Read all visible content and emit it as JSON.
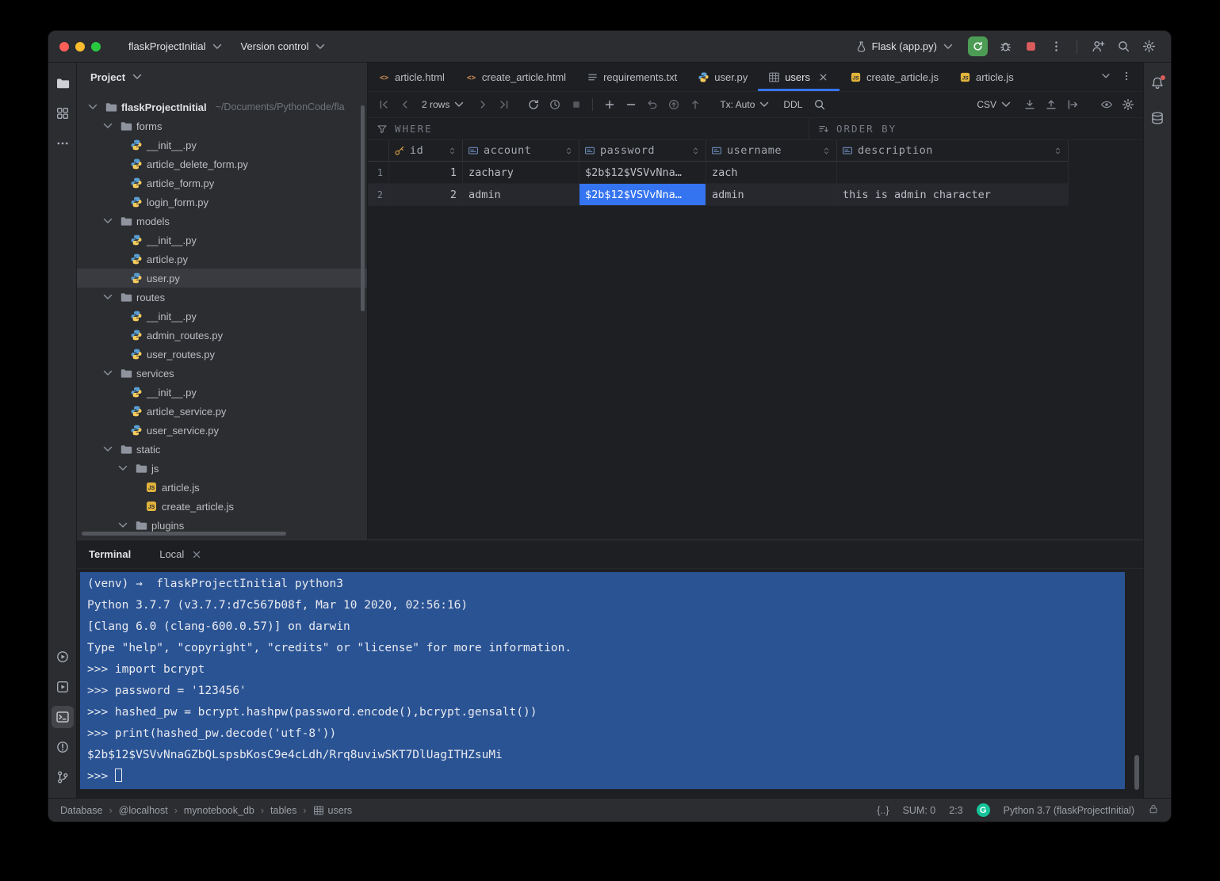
{
  "window": {
    "titlebar": {
      "project_menu": "flaskProjectInitial",
      "vcs_menu": "Version control",
      "run_config": "Flask (app.py)"
    }
  },
  "activity_bar": {
    "top": [
      "project",
      "structure",
      "more"
    ],
    "bottom": [
      "run",
      "services",
      "terminal",
      "problems",
      "version-control"
    ],
    "active": "terminal"
  },
  "right_bar": [
    "notifications",
    "database"
  ],
  "project": {
    "header": "Project",
    "tree": [
      {
        "depth": 0,
        "kind": "folder",
        "label": "flaskProjectInitial",
        "suffix": "~/Documents/PythonCode/fla",
        "expanded": true
      },
      {
        "depth": 1,
        "kind": "folder",
        "label": "forms",
        "expanded": true
      },
      {
        "depth": 2,
        "kind": "py",
        "label": "__init__.py"
      },
      {
        "depth": 2,
        "kind": "py",
        "label": "article_delete_form.py"
      },
      {
        "depth": 2,
        "kind": "py",
        "label": "article_form.py"
      },
      {
        "depth": 2,
        "kind": "py",
        "label": "login_form.py"
      },
      {
        "depth": 1,
        "kind": "folder",
        "label": "models",
        "expanded": true
      },
      {
        "depth": 2,
        "kind": "py",
        "label": "__init__.py"
      },
      {
        "depth": 2,
        "kind": "py",
        "label": "article.py"
      },
      {
        "depth": 2,
        "kind": "py",
        "label": "user.py",
        "selected": true
      },
      {
        "depth": 1,
        "kind": "folder",
        "label": "routes",
        "expanded": true
      },
      {
        "depth": 2,
        "kind": "py",
        "label": "__init__.py"
      },
      {
        "depth": 2,
        "kind": "py",
        "label": "admin_routes.py"
      },
      {
        "depth": 2,
        "kind": "py",
        "label": "user_routes.py"
      },
      {
        "depth": 1,
        "kind": "folder",
        "label": "services",
        "expanded": true
      },
      {
        "depth": 2,
        "kind": "py",
        "label": "__init__.py"
      },
      {
        "depth": 2,
        "kind": "py",
        "label": "article_service.py"
      },
      {
        "depth": 2,
        "kind": "py",
        "label": "user_service.py"
      },
      {
        "depth": 1,
        "kind": "folder",
        "label": "static",
        "expanded": true
      },
      {
        "depth": 2,
        "kind": "folder",
        "label": "js",
        "expanded": true
      },
      {
        "depth": 3,
        "kind": "js",
        "label": "article.js"
      },
      {
        "depth": 3,
        "kind": "js",
        "label": "create_article.js"
      },
      {
        "depth": 2,
        "kind": "folder",
        "label": "plugins",
        "expanded": true
      }
    ]
  },
  "editor": {
    "tabs": [
      {
        "label": "article.html",
        "kind": "html"
      },
      {
        "label": "create_article.html",
        "kind": "html"
      },
      {
        "label": "requirements.txt",
        "kind": "txt"
      },
      {
        "label": "user.py",
        "kind": "py"
      },
      {
        "label": "users",
        "kind": "table",
        "active": true
      },
      {
        "label": "create_article.js",
        "kind": "js"
      },
      {
        "label": "article.js",
        "kind": "js"
      }
    ],
    "toolbar": {
      "rows_label": "2 rows",
      "tx_label": "Tx: Auto",
      "ddl_label": "DDL",
      "csv_label": "CSV"
    },
    "filter": {
      "where_label": "WHERE",
      "order_by_label": "ORDER BY"
    },
    "table": {
      "columns": [
        {
          "name": "id",
          "icon": "key"
        },
        {
          "name": "account",
          "icon": "field"
        },
        {
          "name": "password",
          "icon": "field"
        },
        {
          "name": "username",
          "icon": "field"
        },
        {
          "name": "description",
          "icon": "field"
        }
      ],
      "rows": [
        [
          "1",
          "zachary",
          "$2b$12$VSVvNna…",
          "zach",
          ""
        ],
        [
          "2",
          "admin",
          "$2b$12$VSVvNna…",
          "admin",
          "this is admin character"
        ]
      ],
      "selected_cell": {
        "row_index": 1,
        "column": "password"
      }
    }
  },
  "terminal": {
    "title": "Terminal",
    "tab_label": "Local",
    "lines": [
      "(venv) →  flaskProjectInitial python3",
      "Python 3.7.7 (v3.7.7:d7c567b08f, Mar 10 2020, 02:56:16)",
      "[Clang 6.0 (clang-600.0.57)] on darwin",
      "Type \"help\", \"copyright\", \"credits\" or \"license\" for more information.",
      ">>> import bcrypt",
      ">>> password = '123456'",
      ">>> hashed_pw = bcrypt.hashpw(password.encode(),bcrypt.gensalt())",
      ">>> print(hashed_pw.decode('utf-8'))",
      "$2b$12$VSVvNnaGZbQLspsbKosC9e4cLdh/Rrq8uviwSKT7DlUagITHZsuMi"
    ],
    "prompt": ">>>"
  },
  "status_bar": {
    "breadcrumbs": [
      "Database",
      "@localhost",
      "mynotebook_db",
      "tables",
      "users"
    ],
    "separator": "›",
    "braces": "{..}",
    "sum": "SUM: 0",
    "caret": "2:3",
    "grammarly": "G",
    "interpreter": "Python 3.7 (flaskProjectInitial)"
  },
  "colors": {
    "accent_blue": "#3574F0",
    "selected_cell_blue": "#3574F0",
    "terminal_selection_blue": "#2A5394",
    "run_green": "#4D9C55",
    "stop_red": "#DB5C5C",
    "python_blue": "#5A9FD4",
    "python_yellow": "#F5CB5C",
    "grammarly_green": "#15C39A",
    "panel_bg": "#2B2D30",
    "editor_bg": "#1E1F22"
  }
}
